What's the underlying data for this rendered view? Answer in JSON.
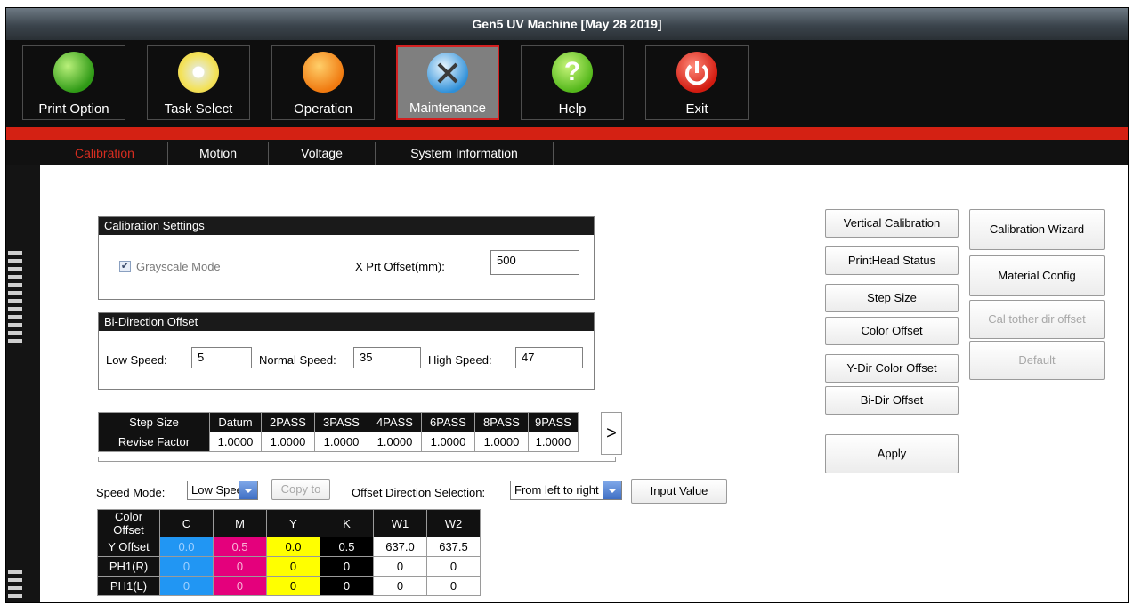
{
  "window": {
    "title": "Gen5 UV Machine [May 28 2019]"
  },
  "toolbar": [
    {
      "label": "Print Option",
      "icon": "print-option-icon"
    },
    {
      "label": "Task Select",
      "icon": "task-select-icon"
    },
    {
      "label": "Operation",
      "icon": "operation-icon"
    },
    {
      "label": "Maintenance",
      "icon": "maintenance-icon"
    },
    {
      "label": "Help",
      "icon": "help-icon"
    },
    {
      "label": "Exit",
      "icon": "exit-icon"
    }
  ],
  "tabs": [
    "Calibration",
    "Motion",
    "Voltage",
    "System Information"
  ],
  "calibration_settings": {
    "title": "Calibration Settings",
    "grayscale_label": "Grayscale Mode",
    "grayscale_checked": true,
    "offset_label": "X Prt Offset(mm):",
    "offset_value": "500"
  },
  "bidirection": {
    "title": "Bi-Direction Offset",
    "low_label": "Low Speed:",
    "low_value": "5",
    "normal_label": "Normal Speed:",
    "normal_value": "35",
    "high_label": "High Speed:",
    "high_value": "47"
  },
  "step_table": {
    "row1_label": "Step Size",
    "row2_label": "Revise Factor",
    "headers": [
      "Datum",
      "2PASS",
      "3PASS",
      "4PASS",
      "6PASS",
      "8PASS",
      "9PASS"
    ],
    "values": [
      "1.0000",
      "1.0000",
      "1.0000",
      "1.0000",
      "1.0000",
      "1.0000",
      "1.0000"
    ],
    "next_arrow": ">"
  },
  "controls": {
    "speed_mode_label": "Speed Mode:",
    "speed_mode_value": "Low Speed",
    "copy_to": "Copy to",
    "offset_dir_label": "Offset Direction Selection:",
    "offset_dir_value": "From left to right",
    "input_value": "Input Value"
  },
  "color_table": {
    "corner": "Color Offset",
    "headers": [
      "C",
      "M",
      "Y",
      "K",
      "W1",
      "W2"
    ],
    "rows": [
      {
        "label": "Y Offset",
        "values": [
          "0.0",
          "0.5",
          "0.0",
          "0.5",
          "637.0",
          "637.5"
        ]
      },
      {
        "label": "PH1(R)",
        "values": [
          "0",
          "0",
          "0",
          "0",
          "0",
          "0"
        ]
      },
      {
        "label": "PH1(L)",
        "values": [
          "0",
          "0",
          "0",
          "0",
          "0",
          "0"
        ]
      }
    ],
    "colors": {
      "C": "#2196f3",
      "M": "#e4007c",
      "Y": "#ffff00",
      "K": "#000000"
    }
  },
  "right_buttons": {
    "col1": [
      "Vertical Calibration",
      "PrintHead Status",
      "Step Size",
      "Color Offset",
      "Y-Dir Color Offset",
      "Bi-Dir Offset"
    ],
    "apply": "Apply",
    "col2": [
      "Calibration Wizard",
      "Material Config",
      "Cal tother dir offset",
      "Default"
    ]
  }
}
